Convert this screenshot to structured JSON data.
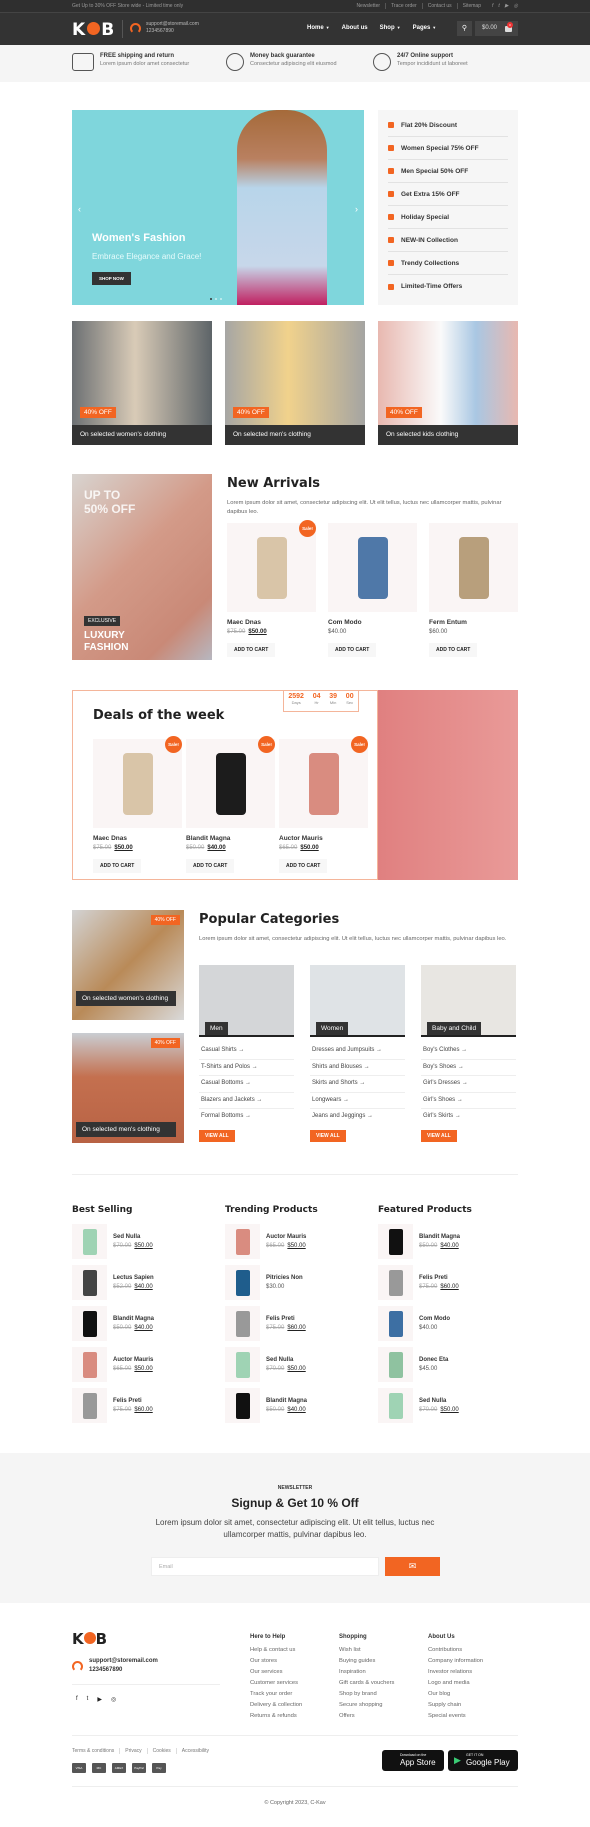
{
  "topbar": {
    "promo": "Get Up to 30% OFF Store wide - Limited time only",
    "links": [
      "Newsletter",
      "Trace order",
      "Contact us",
      "Sitemap"
    ],
    "social": [
      "facebook-icon",
      "twitter-icon",
      "youtube-icon",
      "instagram-icon"
    ]
  },
  "header": {
    "logo": "KOB",
    "email": "support@storemail.com",
    "phone": "1234567890",
    "nav": [
      {
        "label": "Home",
        "dropdown": true
      },
      {
        "label": "About us",
        "dropdown": false
      },
      {
        "label": "Shop",
        "dropdown": true
      },
      {
        "label": "Pages",
        "dropdown": true
      }
    ],
    "cart_total": "$0.00",
    "cart_count": "0"
  },
  "features": [
    {
      "icon": "truck-icon",
      "title": "FREE shipping and return",
      "text": "Lorem ipsum dolor amet consectetur"
    },
    {
      "icon": "medal-icon",
      "title": "Money back guarantee",
      "text": "Consectetur adipiscing elit eiusmod"
    },
    {
      "icon": "support-24-icon",
      "title": "24/7 Online support",
      "text": "Tempor incididunt ut laboreet"
    }
  ],
  "hero": {
    "title": "Women's Fashion",
    "subtitle": "Embrace Elegance and Grace!",
    "button": "SHOP NOW",
    "slides": 3,
    "active_slide": 1
  },
  "offers": [
    {
      "icon": "tag-icon",
      "label": "Flat 20% Discount"
    },
    {
      "icon": "crown-icon",
      "label": "Women Special 75% OFF"
    },
    {
      "icon": "crown-icon",
      "label": "Men Special 50% OFF"
    },
    {
      "icon": "ticket-icon",
      "label": "Get Extra 15% OFF"
    },
    {
      "icon": "cocktail-icon",
      "label": "Holiday Special"
    },
    {
      "icon": "star-icon",
      "label": "NEW-IN Collection"
    },
    {
      "icon": "hand-icon",
      "label": "Trendy Collections"
    },
    {
      "icon": "clock-icon",
      "label": "Limited-Time Offers"
    }
  ],
  "promos": [
    {
      "badge": "40% OFF",
      "caption": "On selected women's clothing"
    },
    {
      "badge": "40% OFF",
      "caption": "On selected men's clothing"
    },
    {
      "badge": "40% OFF",
      "caption": "On selected kids clothing"
    }
  ],
  "luxury": {
    "headline": "UP TO 50% OFF",
    "tag": "EXCLUSIVE",
    "title": "LUXURY FASHION"
  },
  "new_arrivals": {
    "title": "New Arrivals",
    "desc": "Lorem ipsum dolor sit amet, consectetur adipiscing elit. Ut elit tellus, luctus nec ullamcorper mattis, pulvinar dapibus leo.",
    "products": [
      {
        "name": "Maec Dnas",
        "old": "$75.00",
        "price": "$50.00",
        "sale": "Sale!",
        "button": "ADD TO CART"
      },
      {
        "name": "Com Modo",
        "old": "",
        "price": "$40.00",
        "sale": "",
        "button": "ADD TO CART"
      },
      {
        "name": "Ferm Entum",
        "old": "",
        "price": "$60.00",
        "sale": "",
        "button": "ADD TO CART"
      }
    ]
  },
  "deals": {
    "title": "Deals of the week",
    "timer": [
      {
        "value": "2592",
        "unit": "Days"
      },
      {
        "value": "04",
        "unit": "Hr"
      },
      {
        "value": "39",
        "unit": "Min"
      },
      {
        "value": "00",
        "unit": "Sec"
      }
    ],
    "products": [
      {
        "name": "Maec Dnas",
        "old": "$75.00",
        "price": "$50.00",
        "sale": "Sale!",
        "button": "ADD TO CART"
      },
      {
        "name": "Blandit Magna",
        "old": "$50.00",
        "price": "$40.00",
        "sale": "Sale!",
        "button": "ADD TO CART"
      },
      {
        "name": "Auctor Mauris",
        "old": "$65.00",
        "price": "$50.00",
        "sale": "Sale!",
        "button": "ADD TO CART"
      }
    ]
  },
  "side_promos": [
    {
      "badge": "40% OFF",
      "caption": "On selected women's clothing"
    },
    {
      "badge": "40% OFF",
      "caption": "On selected men's clothing"
    }
  ],
  "popular": {
    "title": "Popular Categories",
    "desc": "Lorem ipsum dolor sit amet, consectetur adipiscing elit. Ut elit tellus, luctus nec ullamcorper mattis, pulvinar dapibus leo.",
    "view_all": "VIEW ALL",
    "categories": [
      {
        "label": "Men",
        "items": [
          "Casual Shirts",
          "T-Shirts and Polos",
          "Casual Bottoms",
          "Blazers and Jackets",
          "Formal Bottoms"
        ]
      },
      {
        "label": "Women",
        "items": [
          "Dresses and Jumpsuits",
          "Shirts and Blouses",
          "Skirts and Shorts",
          "Longwears",
          "Jeans and Jeggings"
        ]
      },
      {
        "label": "Baby and Child",
        "items": [
          "Boy's Clothes",
          "Boy's Shoes",
          "Girl's Dresses",
          "Girl's Shoes",
          "Girl's Skirts"
        ]
      }
    ]
  },
  "lists": [
    {
      "title": "Best Selling",
      "items": [
        {
          "name": "Sed Nulla",
          "old": "$70.00",
          "price": "$50.00",
          "color": "#9fd3b4"
        },
        {
          "name": "Lectus Sapien",
          "old": "$52.00",
          "price": "$40.00",
          "color": "#444"
        },
        {
          "name": "Blandit Magna",
          "old": "$50.00",
          "price": "$40.00",
          "color": "#111"
        },
        {
          "name": "Auctor Mauris",
          "old": "$65.00",
          "price": "$50.00",
          "color": "#d98c80"
        },
        {
          "name": "Felis Preti",
          "old": "$75.00",
          "price": "$60.00",
          "color": "#999"
        }
      ]
    },
    {
      "title": "Trending Products",
      "items": [
        {
          "name": "Auctor Mauris",
          "old": "$65.00",
          "price": "$50.00",
          "color": "#d98c80"
        },
        {
          "name": "Pitricies Non",
          "old": "",
          "price": "$30.00",
          "color": "#1f5d8c"
        },
        {
          "name": "Felis Preti",
          "old": "$75.00",
          "price": "$60.00",
          "color": "#999"
        },
        {
          "name": "Sed Nulla",
          "old": "$70.00",
          "price": "$50.00",
          "color": "#9fd3b4"
        },
        {
          "name": "Blandit Magna",
          "old": "$50.00",
          "price": "$40.00",
          "color": "#111"
        }
      ]
    },
    {
      "title": "Featured Products",
      "items": [
        {
          "name": "Blandit Magna",
          "old": "$50.00",
          "price": "$40.00",
          "color": "#111"
        },
        {
          "name": "Felis Preti",
          "old": "$75.00",
          "price": "$60.00",
          "color": "#999"
        },
        {
          "name": "Com Modo",
          "old": "",
          "price": "$40.00",
          "color": "#3d6fa3"
        },
        {
          "name": "Donec Eta",
          "old": "",
          "price": "$45.00",
          "color": "#8fc2a0"
        },
        {
          "name": "Sed Nulla",
          "old": "$70.00",
          "price": "$50.00",
          "color": "#9fd3b4"
        }
      ]
    }
  ],
  "newsletter": {
    "kicker": "NEWSLETTER",
    "title": "Signup & Get 10 % Off",
    "text": "Lorem ipsum dolor sit amet, consectetur adipiscing elit. Ut elit tellus, luctus nec ullamcorper mattis, pulvinar dapibus leo.",
    "placeholder": "Email"
  },
  "footer": {
    "logo": "KOB",
    "email": "support@storemail.com",
    "phone": "1234567890",
    "columns": [
      {
        "title": "Here to Help",
        "links": [
          "Help & contact us",
          "Our stores",
          "Our services",
          "Customer services",
          "Track your order",
          "Delivery & collection",
          "Returns & refunds"
        ]
      },
      {
        "title": "Shopping",
        "links": [
          "Wish list",
          "Buying guides",
          "Inspiration",
          "Gift cards & vouchers",
          "Shop by brand",
          "Secure shopping",
          "Offers"
        ]
      },
      {
        "title": "About Us",
        "links": [
          "Contributions",
          "Company information",
          "Investor relations",
          "Logo and media",
          "Our blog",
          "Supply chain",
          "Special events"
        ]
      }
    ],
    "legal": [
      "Terms & conditions",
      "Privacy",
      "Cookies",
      "Accessibility"
    ],
    "payments": [
      "VISA",
      "MC",
      "AMEX",
      "PayPal",
      "Pay"
    ],
    "app_store": {
      "small": "Download on the",
      "big": "App Store"
    },
    "google_play": {
      "small": "GET IT ON",
      "big": "Google Play"
    },
    "copyright": "© Copyright 2023, C-Kav"
  },
  "colors": {
    "accent": "#f26522",
    "dark": "#333333"
  }
}
